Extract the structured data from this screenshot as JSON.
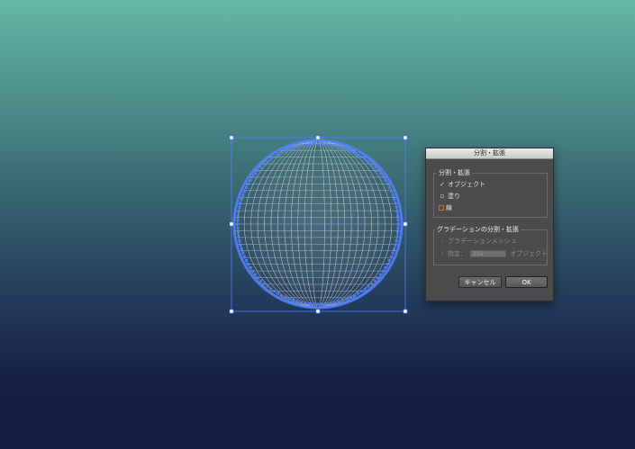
{
  "dialog": {
    "title": "分割・拡張",
    "group1": {
      "title": "分割・拡張",
      "items": [
        {
          "label": "オブジェクト",
          "checked": true
        },
        {
          "label": "塗り",
          "checked": false
        },
        {
          "label": "線",
          "checked": false
        }
      ]
    },
    "group2": {
      "title": "グラデーションの分割・拡張",
      "option_mesh": "グラデーションメッシュ",
      "option_specify_label": "指定：",
      "specify_value": "255",
      "specify_unit": "オブジェクト"
    },
    "buttons": {
      "cancel": "キャンセル",
      "ok": "OK"
    }
  },
  "colors": {
    "selection": "#4f7fff",
    "mesh_line": "#d6d6d6"
  }
}
